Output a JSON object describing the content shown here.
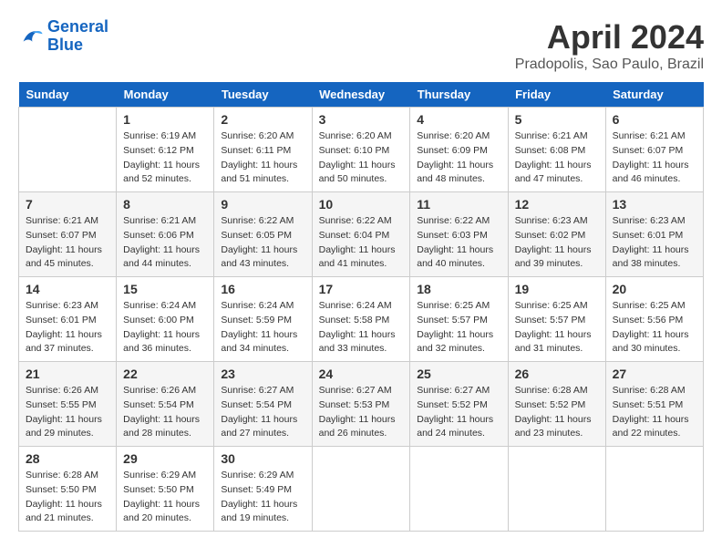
{
  "header": {
    "logo_line1": "General",
    "logo_line2": "Blue",
    "month_title": "April 2024",
    "location": "Pradopolis, Sao Paulo, Brazil"
  },
  "days_of_week": [
    "Sunday",
    "Monday",
    "Tuesday",
    "Wednesday",
    "Thursday",
    "Friday",
    "Saturday"
  ],
  "weeks": [
    [
      {
        "num": "",
        "sunrise": "",
        "sunset": "",
        "daylight": ""
      },
      {
        "num": "1",
        "sunrise": "Sunrise: 6:19 AM",
        "sunset": "Sunset: 6:12 PM",
        "daylight": "Daylight: 11 hours and 52 minutes."
      },
      {
        "num": "2",
        "sunrise": "Sunrise: 6:20 AM",
        "sunset": "Sunset: 6:11 PM",
        "daylight": "Daylight: 11 hours and 51 minutes."
      },
      {
        "num": "3",
        "sunrise": "Sunrise: 6:20 AM",
        "sunset": "Sunset: 6:10 PM",
        "daylight": "Daylight: 11 hours and 50 minutes."
      },
      {
        "num": "4",
        "sunrise": "Sunrise: 6:20 AM",
        "sunset": "Sunset: 6:09 PM",
        "daylight": "Daylight: 11 hours and 48 minutes."
      },
      {
        "num": "5",
        "sunrise": "Sunrise: 6:21 AM",
        "sunset": "Sunset: 6:08 PM",
        "daylight": "Daylight: 11 hours and 47 minutes."
      },
      {
        "num": "6",
        "sunrise": "Sunrise: 6:21 AM",
        "sunset": "Sunset: 6:07 PM",
        "daylight": "Daylight: 11 hours and 46 minutes."
      }
    ],
    [
      {
        "num": "7",
        "sunrise": "Sunrise: 6:21 AM",
        "sunset": "Sunset: 6:07 PM",
        "daylight": "Daylight: 11 hours and 45 minutes."
      },
      {
        "num": "8",
        "sunrise": "Sunrise: 6:21 AM",
        "sunset": "Sunset: 6:06 PM",
        "daylight": "Daylight: 11 hours and 44 minutes."
      },
      {
        "num": "9",
        "sunrise": "Sunrise: 6:22 AM",
        "sunset": "Sunset: 6:05 PM",
        "daylight": "Daylight: 11 hours and 43 minutes."
      },
      {
        "num": "10",
        "sunrise": "Sunrise: 6:22 AM",
        "sunset": "Sunset: 6:04 PM",
        "daylight": "Daylight: 11 hours and 41 minutes."
      },
      {
        "num": "11",
        "sunrise": "Sunrise: 6:22 AM",
        "sunset": "Sunset: 6:03 PM",
        "daylight": "Daylight: 11 hours and 40 minutes."
      },
      {
        "num": "12",
        "sunrise": "Sunrise: 6:23 AM",
        "sunset": "Sunset: 6:02 PM",
        "daylight": "Daylight: 11 hours and 39 minutes."
      },
      {
        "num": "13",
        "sunrise": "Sunrise: 6:23 AM",
        "sunset": "Sunset: 6:01 PM",
        "daylight": "Daylight: 11 hours and 38 minutes."
      }
    ],
    [
      {
        "num": "14",
        "sunrise": "Sunrise: 6:23 AM",
        "sunset": "Sunset: 6:01 PM",
        "daylight": "Daylight: 11 hours and 37 minutes."
      },
      {
        "num": "15",
        "sunrise": "Sunrise: 6:24 AM",
        "sunset": "Sunset: 6:00 PM",
        "daylight": "Daylight: 11 hours and 36 minutes."
      },
      {
        "num": "16",
        "sunrise": "Sunrise: 6:24 AM",
        "sunset": "Sunset: 5:59 PM",
        "daylight": "Daylight: 11 hours and 34 minutes."
      },
      {
        "num": "17",
        "sunrise": "Sunrise: 6:24 AM",
        "sunset": "Sunset: 5:58 PM",
        "daylight": "Daylight: 11 hours and 33 minutes."
      },
      {
        "num": "18",
        "sunrise": "Sunrise: 6:25 AM",
        "sunset": "Sunset: 5:57 PM",
        "daylight": "Daylight: 11 hours and 32 minutes."
      },
      {
        "num": "19",
        "sunrise": "Sunrise: 6:25 AM",
        "sunset": "Sunset: 5:57 PM",
        "daylight": "Daylight: 11 hours and 31 minutes."
      },
      {
        "num": "20",
        "sunrise": "Sunrise: 6:25 AM",
        "sunset": "Sunset: 5:56 PM",
        "daylight": "Daylight: 11 hours and 30 minutes."
      }
    ],
    [
      {
        "num": "21",
        "sunrise": "Sunrise: 6:26 AM",
        "sunset": "Sunset: 5:55 PM",
        "daylight": "Daylight: 11 hours and 29 minutes."
      },
      {
        "num": "22",
        "sunrise": "Sunrise: 6:26 AM",
        "sunset": "Sunset: 5:54 PM",
        "daylight": "Daylight: 11 hours and 28 minutes."
      },
      {
        "num": "23",
        "sunrise": "Sunrise: 6:27 AM",
        "sunset": "Sunset: 5:54 PM",
        "daylight": "Daylight: 11 hours and 27 minutes."
      },
      {
        "num": "24",
        "sunrise": "Sunrise: 6:27 AM",
        "sunset": "Sunset: 5:53 PM",
        "daylight": "Daylight: 11 hours and 26 minutes."
      },
      {
        "num": "25",
        "sunrise": "Sunrise: 6:27 AM",
        "sunset": "Sunset: 5:52 PM",
        "daylight": "Daylight: 11 hours and 24 minutes."
      },
      {
        "num": "26",
        "sunrise": "Sunrise: 6:28 AM",
        "sunset": "Sunset: 5:52 PM",
        "daylight": "Daylight: 11 hours and 23 minutes."
      },
      {
        "num": "27",
        "sunrise": "Sunrise: 6:28 AM",
        "sunset": "Sunset: 5:51 PM",
        "daylight": "Daylight: 11 hours and 22 minutes."
      }
    ],
    [
      {
        "num": "28",
        "sunrise": "Sunrise: 6:28 AM",
        "sunset": "Sunset: 5:50 PM",
        "daylight": "Daylight: 11 hours and 21 minutes."
      },
      {
        "num": "29",
        "sunrise": "Sunrise: 6:29 AM",
        "sunset": "Sunset: 5:50 PM",
        "daylight": "Daylight: 11 hours and 20 minutes."
      },
      {
        "num": "30",
        "sunrise": "Sunrise: 6:29 AM",
        "sunset": "Sunset: 5:49 PM",
        "daylight": "Daylight: 11 hours and 19 minutes."
      },
      {
        "num": "",
        "sunrise": "",
        "sunset": "",
        "daylight": ""
      },
      {
        "num": "",
        "sunrise": "",
        "sunset": "",
        "daylight": ""
      },
      {
        "num": "",
        "sunrise": "",
        "sunset": "",
        "daylight": ""
      },
      {
        "num": "",
        "sunrise": "",
        "sunset": "",
        "daylight": ""
      }
    ]
  ]
}
